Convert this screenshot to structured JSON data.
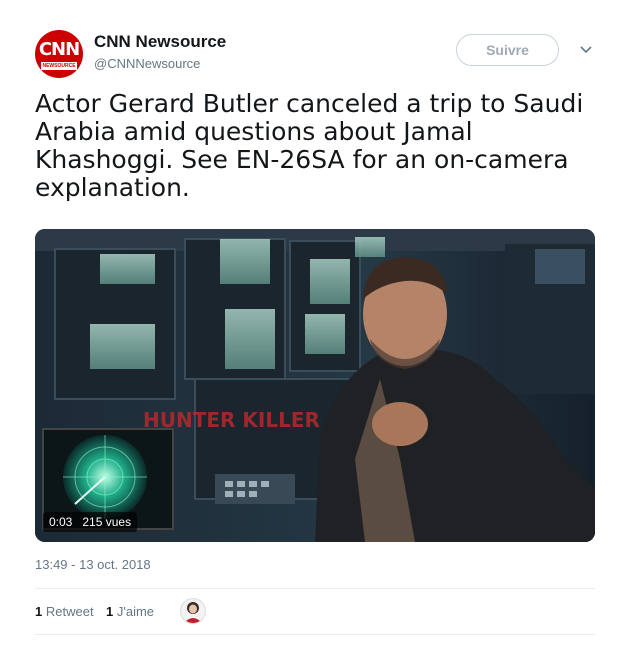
{
  "account": {
    "display_name": "CNN Newsource",
    "handle": "@CNNNewsource",
    "avatar_logo": "CNN",
    "avatar_sub": "NEWSOURCE"
  },
  "follow_button": "Suivre",
  "tweet": {
    "text": "Actor Gerard Butler canceled a trip to Saudi Arabia amid questions about Jamal Khashoggi. See EN-26SA for an on-camera explanation.",
    "timestamp": "13:49 - 13 oct. 2018"
  },
  "media": {
    "duration": "0:03",
    "views": "215 vues",
    "overlay_title": "HUNTER KILLER"
  },
  "stats": {
    "retweets_count": "1",
    "retweets_label": "Retweet",
    "likes_count": "1",
    "likes_label": "J'aime"
  },
  "colors": {
    "brand_red": "#cc0000",
    "text_primary": "#14171a",
    "text_secondary": "#657786"
  }
}
